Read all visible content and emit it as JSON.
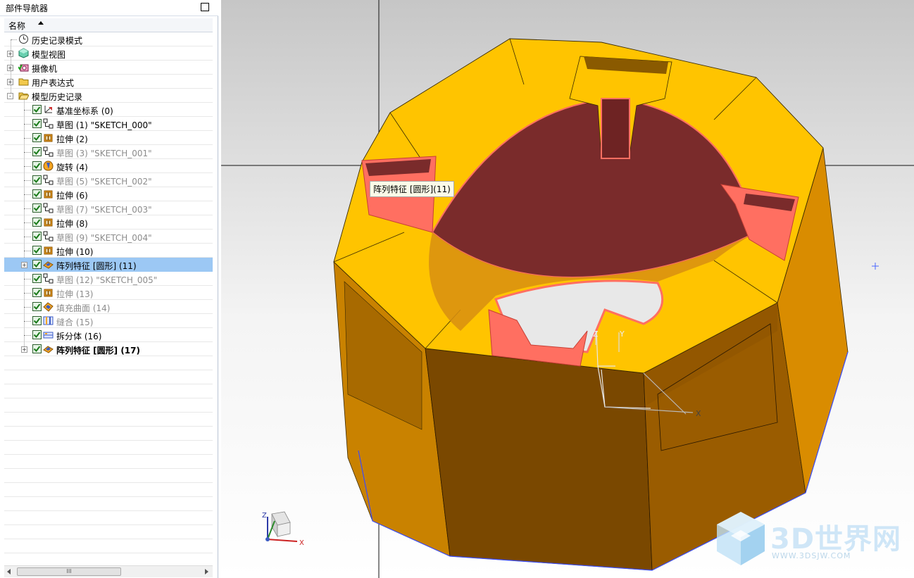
{
  "navigator": {
    "title": "部件导航器",
    "column_header": "名称",
    "items": [
      {
        "label": "历史记录模式",
        "icon": "clock-icon",
        "indent": 0,
        "expander": "",
        "checkbox": false,
        "style": "normal"
      },
      {
        "label": "模型视图",
        "icon": "model-view-icon",
        "indent": 0,
        "expander": "+",
        "checkbox": false,
        "style": "normal"
      },
      {
        "label": "摄像机",
        "icon": "camera-icon",
        "indent": 0,
        "expander": "+",
        "checkbox": false,
        "style": "normal"
      },
      {
        "label": "用户表达式",
        "icon": "folder-icon",
        "indent": 0,
        "expander": "+",
        "checkbox": false,
        "style": "normal"
      },
      {
        "label": "模型历史记录",
        "icon": "folder-open-icon",
        "indent": 0,
        "expander": "-",
        "checkbox": false,
        "style": "normal"
      },
      {
        "label": "基准坐标系 (0)",
        "icon": "datum-csys-icon",
        "indent": 1,
        "expander": "",
        "checkbox": true,
        "style": "normal"
      },
      {
        "label": "草图 (1) \"SKETCH_000\"",
        "icon": "sketch-icon",
        "indent": 1,
        "expander": "",
        "checkbox": true,
        "style": "normal"
      },
      {
        "label": "拉伸 (2)",
        "icon": "extrude-icon",
        "indent": 1,
        "expander": "",
        "checkbox": true,
        "style": "normal"
      },
      {
        "label": "草图 (3) \"SKETCH_001\"",
        "icon": "sketch-icon",
        "indent": 1,
        "expander": "",
        "checkbox": true,
        "style": "dim"
      },
      {
        "label": "旋转 (4)",
        "icon": "revolve-icon",
        "indent": 1,
        "expander": "",
        "checkbox": true,
        "style": "normal"
      },
      {
        "label": "草图 (5) \"SKETCH_002\"",
        "icon": "sketch-icon",
        "indent": 1,
        "expander": "",
        "checkbox": true,
        "style": "dim"
      },
      {
        "label": "拉伸 (6)",
        "icon": "extrude-icon",
        "indent": 1,
        "expander": "",
        "checkbox": true,
        "style": "normal"
      },
      {
        "label": "草图 (7) \"SKETCH_003\"",
        "icon": "sketch-icon",
        "indent": 1,
        "expander": "",
        "checkbox": true,
        "style": "dim"
      },
      {
        "label": "拉伸 (8)",
        "icon": "extrude-icon",
        "indent": 1,
        "expander": "",
        "checkbox": true,
        "style": "normal"
      },
      {
        "label": "草图 (9) \"SKETCH_004\"",
        "icon": "sketch-icon",
        "indent": 1,
        "expander": "",
        "checkbox": true,
        "style": "dim"
      },
      {
        "label": "拉伸 (10)",
        "icon": "extrude-icon",
        "indent": 1,
        "expander": "",
        "checkbox": true,
        "style": "normal"
      },
      {
        "label": "阵列特征 [圆形] (11)",
        "icon": "pattern-feature-icon",
        "indent": 1,
        "expander": "+",
        "checkbox": true,
        "style": "selected"
      },
      {
        "label": "草图 (12) \"SKETCH_005\"",
        "icon": "sketch-icon",
        "indent": 1,
        "expander": "",
        "checkbox": true,
        "style": "dim"
      },
      {
        "label": "拉伸 (13)",
        "icon": "extrude-icon",
        "indent": 1,
        "expander": "",
        "checkbox": true,
        "style": "dim"
      },
      {
        "label": "填充曲面 (14)",
        "icon": "fill-surface-icon",
        "indent": 1,
        "expander": "",
        "checkbox": true,
        "style": "dim"
      },
      {
        "label": "缝合 (15)",
        "icon": "sew-icon",
        "indent": 1,
        "expander": "",
        "checkbox": true,
        "style": "dim"
      },
      {
        "label": "拆分体 (16)",
        "icon": "split-body-icon",
        "indent": 1,
        "expander": "",
        "checkbox": true,
        "style": "normal"
      },
      {
        "label": "阵列特征 [圆形] (17)",
        "icon": "pattern-feature-icon",
        "indent": 1,
        "expander": "+",
        "checkbox": true,
        "style": "bold"
      }
    ],
    "scrollbar_thumb": "III"
  },
  "viewport": {
    "tooltip": "阵列特征 [圆形](11)",
    "wcs_labels": {
      "x": "X",
      "y": "Y",
      "z": "Z"
    },
    "triad_labels": {
      "x": "X",
      "z": "Z"
    }
  },
  "watermark": {
    "title": "3D世界网",
    "url": "WWW.3DSJW.COM"
  },
  "colors": {
    "model_top": "#ffc200",
    "model_side": "#8a4d00",
    "model_cut": "#7a2a2a",
    "highlight": "#ff6f61",
    "selection": "#9cc8f4"
  }
}
